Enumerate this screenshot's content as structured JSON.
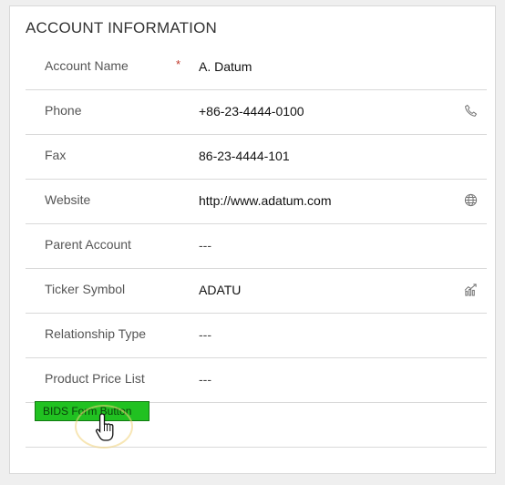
{
  "section": {
    "title": "ACCOUNT INFORMATION"
  },
  "required_marker": "*",
  "fields": [
    {
      "label": "Account Name",
      "value": "A. Datum",
      "required": true
    },
    {
      "label": "Phone",
      "value": "+86-23-4444-0100",
      "icon": "phone-icon"
    },
    {
      "label": "Fax",
      "value": "86-23-4444-101"
    },
    {
      "label": "Website",
      "value": "http://www.adatum.com",
      "icon": "globe-icon"
    },
    {
      "label": "Parent Account",
      "value": "---"
    },
    {
      "label": "Ticker Symbol",
      "value": "ADATU",
      "icon": "stock-chart-icon"
    },
    {
      "label": "Relationship Type",
      "value": "---"
    },
    {
      "label": "Product Price List",
      "value": "---"
    }
  ],
  "bids_button": {
    "label": "BIDS Form Button",
    "color": "#21c121"
  },
  "colors": {
    "required": "#c0392b",
    "divider": "#d9d9d9",
    "background": "#efefef"
  }
}
